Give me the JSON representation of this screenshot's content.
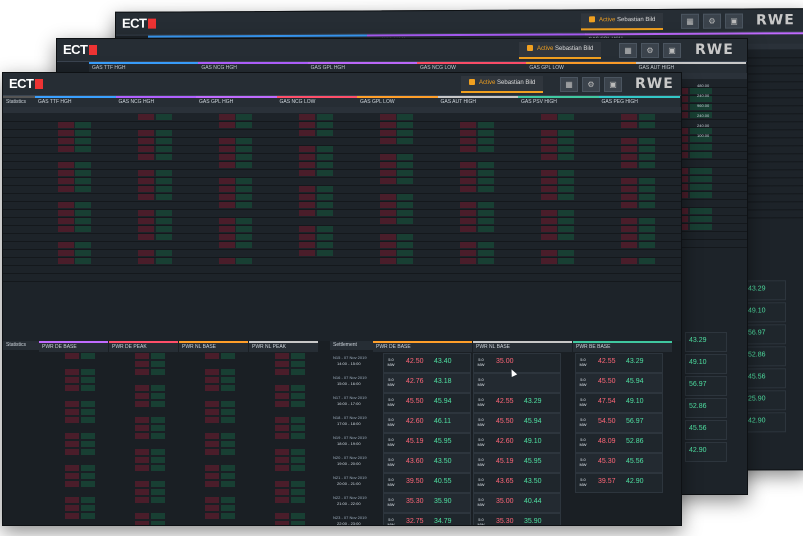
{
  "app": {
    "logo": "ECT",
    "user_role": "Active",
    "user_name": "Sebastian Bild",
    "brand": "RWE"
  },
  "sections_front": [
    "GAS TTF HGH",
    "GAS NCG HGH",
    "GAS GPL HGH",
    "GAS NCG LOW",
    "GAS GPL LOW",
    "GAS AUT HIGH",
    "GAS PSV HIGH",
    "GAS PEG HIGH"
  ],
  "sections_mid": [
    "GAS TTF HGH",
    "GAS NCG HGH",
    "GAS GPL HGH",
    "GAS NCG LOW",
    "GAS GPL LOW",
    "GAS AUT HIGH"
  ],
  "sections_back": [
    "GAS TTF HGH",
    "GAS NCG HGH",
    "GAS GPL HGH"
  ],
  "front": {
    "status_label": "Statistics",
    "bottom_left_label": "Statistics",
    "bottom_sections": [
      "PWR DE BASE",
      "PWR DE PEAK",
      "PWR NL BASE",
      "PWR NL PEAK"
    ],
    "bottom_right_label": "Settlement",
    "tile_sections": [
      "PWR DE BASE",
      "PWR NL BASE",
      "PWR BE BASE"
    ],
    "products": [
      {
        "name": "N15 - 07 Nov 2019",
        "time": "14:00 - 15:00"
      },
      {
        "name": "N16 - 07 Nov 2019",
        "time": "15:00 - 16:00"
      },
      {
        "name": "N17 - 07 Nov 2019",
        "time": "16:00 - 17:00"
      },
      {
        "name": "N18 - 07 Nov 2019",
        "time": "17:00 - 18:00"
      },
      {
        "name": "N19 - 07 Nov 2019",
        "time": "18:00 - 19:00"
      },
      {
        "name": "N20 - 07 Nov 2019",
        "time": "19:00 - 20:00"
      },
      {
        "name": "N21 - 07 Nov 2019",
        "time": "20:00 - 21:00"
      },
      {
        "name": "N22 - 07 Nov 2019",
        "time": "21:00 - 22:00"
      },
      {
        "name": "N23 - 07 Nov 2019",
        "time": "22:00 - 23:00"
      }
    ],
    "tiles_col1": [
      {
        "bid": "42.50",
        "ask": "43.40"
      },
      {
        "bid": "42.76",
        "ask": "43.18"
      },
      {
        "bid": "45.50",
        "ask": "45.94"
      },
      {
        "bid": "42.60",
        "ask": "46.11"
      },
      {
        "bid": "45.19",
        "ask": "45.95"
      },
      {
        "bid": "43.60",
        "ask": "43.50"
      },
      {
        "bid": "39.50",
        "ask": "40.55"
      },
      {
        "bid": "35.30",
        "ask": "35.90"
      },
      {
        "bid": "32.75",
        "ask": "34.79"
      }
    ],
    "tiles_col2": [
      {
        "bid": "35.00",
        "ask": ""
      },
      {
        "bid": "",
        "ask": ""
      },
      {
        "bid": "42.55",
        "ask": "43.29"
      },
      {
        "bid": "45.50",
        "ask": "45.94"
      },
      {
        "bid": "42.60",
        "ask": "49.10"
      },
      {
        "bid": "45.19",
        "ask": "45.95"
      },
      {
        "bid": "43.65",
        "ask": "43.50"
      },
      {
        "bid": "35.00",
        "ask": "40.44"
      },
      {
        "bid": "35.30",
        "ask": "35.90"
      },
      {
        "bid": "33.06",
        "ask": "34.43"
      }
    ],
    "tiles_col3": [
      {
        "bid": "42.55",
        "ask": "43.29"
      },
      {
        "bid": "45.50",
        "ask": "45.94"
      },
      {
        "bid": "47.54",
        "ask": "49.10"
      },
      {
        "bid": "54.50",
        "ask": "56.97"
      },
      {
        "bid": "48.09",
        "ask": "52.86"
      },
      {
        "bid": "45.30",
        "ask": "45.56"
      },
      {
        "bid": "39.57",
        "ask": "42.90"
      }
    ],
    "vol_label": "5.0",
    "vol_unit": "MW"
  },
  "back_right_values": [
    "43.29",
    "49.10",
    "56.97",
    "52.86",
    "45.56",
    "25.90",
    "42.90"
  ],
  "back_mid_values": [
    "43.29",
    "49.10",
    "56.97",
    "52.86",
    "45.56",
    "42.90"
  ],
  "back_header_values": [
    "480.00",
    "240.00",
    "960.00",
    "240.00",
    "240.00",
    "100.00"
  ]
}
